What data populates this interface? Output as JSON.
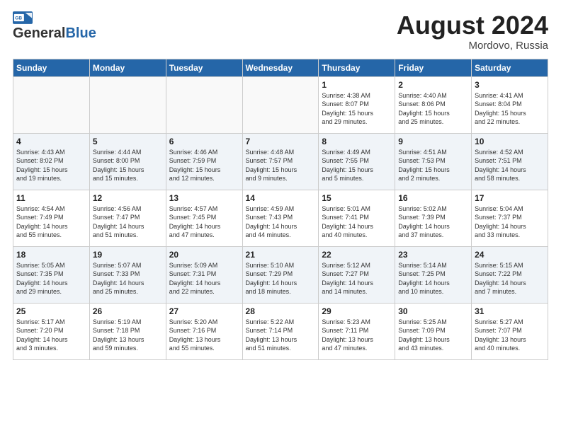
{
  "header": {
    "logo_general": "General",
    "logo_blue": "Blue",
    "month_title": "August 2024",
    "location": "Mordovo, Russia"
  },
  "days_of_week": [
    "Sunday",
    "Monday",
    "Tuesday",
    "Wednesday",
    "Thursday",
    "Friday",
    "Saturday"
  ],
  "weeks": [
    [
      {
        "num": "",
        "info": ""
      },
      {
        "num": "",
        "info": ""
      },
      {
        "num": "",
        "info": ""
      },
      {
        "num": "",
        "info": ""
      },
      {
        "num": "1",
        "info": "Sunrise: 4:38 AM\nSunset: 8:07 PM\nDaylight: 15 hours\nand 29 minutes."
      },
      {
        "num": "2",
        "info": "Sunrise: 4:40 AM\nSunset: 8:06 PM\nDaylight: 15 hours\nand 25 minutes."
      },
      {
        "num": "3",
        "info": "Sunrise: 4:41 AM\nSunset: 8:04 PM\nDaylight: 15 hours\nand 22 minutes."
      }
    ],
    [
      {
        "num": "4",
        "info": "Sunrise: 4:43 AM\nSunset: 8:02 PM\nDaylight: 15 hours\nand 19 minutes."
      },
      {
        "num": "5",
        "info": "Sunrise: 4:44 AM\nSunset: 8:00 PM\nDaylight: 15 hours\nand 15 minutes."
      },
      {
        "num": "6",
        "info": "Sunrise: 4:46 AM\nSunset: 7:59 PM\nDaylight: 15 hours\nand 12 minutes."
      },
      {
        "num": "7",
        "info": "Sunrise: 4:48 AM\nSunset: 7:57 PM\nDaylight: 15 hours\nand 9 minutes."
      },
      {
        "num": "8",
        "info": "Sunrise: 4:49 AM\nSunset: 7:55 PM\nDaylight: 15 hours\nand 5 minutes."
      },
      {
        "num": "9",
        "info": "Sunrise: 4:51 AM\nSunset: 7:53 PM\nDaylight: 15 hours\nand 2 minutes."
      },
      {
        "num": "10",
        "info": "Sunrise: 4:52 AM\nSunset: 7:51 PM\nDaylight: 14 hours\nand 58 minutes."
      }
    ],
    [
      {
        "num": "11",
        "info": "Sunrise: 4:54 AM\nSunset: 7:49 PM\nDaylight: 14 hours\nand 55 minutes."
      },
      {
        "num": "12",
        "info": "Sunrise: 4:56 AM\nSunset: 7:47 PM\nDaylight: 14 hours\nand 51 minutes."
      },
      {
        "num": "13",
        "info": "Sunrise: 4:57 AM\nSunset: 7:45 PM\nDaylight: 14 hours\nand 47 minutes."
      },
      {
        "num": "14",
        "info": "Sunrise: 4:59 AM\nSunset: 7:43 PM\nDaylight: 14 hours\nand 44 minutes."
      },
      {
        "num": "15",
        "info": "Sunrise: 5:01 AM\nSunset: 7:41 PM\nDaylight: 14 hours\nand 40 minutes."
      },
      {
        "num": "16",
        "info": "Sunrise: 5:02 AM\nSunset: 7:39 PM\nDaylight: 14 hours\nand 37 minutes."
      },
      {
        "num": "17",
        "info": "Sunrise: 5:04 AM\nSunset: 7:37 PM\nDaylight: 14 hours\nand 33 minutes."
      }
    ],
    [
      {
        "num": "18",
        "info": "Sunrise: 5:05 AM\nSunset: 7:35 PM\nDaylight: 14 hours\nand 29 minutes."
      },
      {
        "num": "19",
        "info": "Sunrise: 5:07 AM\nSunset: 7:33 PM\nDaylight: 14 hours\nand 25 minutes."
      },
      {
        "num": "20",
        "info": "Sunrise: 5:09 AM\nSunset: 7:31 PM\nDaylight: 14 hours\nand 22 minutes."
      },
      {
        "num": "21",
        "info": "Sunrise: 5:10 AM\nSunset: 7:29 PM\nDaylight: 14 hours\nand 18 minutes."
      },
      {
        "num": "22",
        "info": "Sunrise: 5:12 AM\nSunset: 7:27 PM\nDaylight: 14 hours\nand 14 minutes."
      },
      {
        "num": "23",
        "info": "Sunrise: 5:14 AM\nSunset: 7:25 PM\nDaylight: 14 hours\nand 10 minutes."
      },
      {
        "num": "24",
        "info": "Sunrise: 5:15 AM\nSunset: 7:22 PM\nDaylight: 14 hours\nand 7 minutes."
      }
    ],
    [
      {
        "num": "25",
        "info": "Sunrise: 5:17 AM\nSunset: 7:20 PM\nDaylight: 14 hours\nand 3 minutes."
      },
      {
        "num": "26",
        "info": "Sunrise: 5:19 AM\nSunset: 7:18 PM\nDaylight: 13 hours\nand 59 minutes."
      },
      {
        "num": "27",
        "info": "Sunrise: 5:20 AM\nSunset: 7:16 PM\nDaylight: 13 hours\nand 55 minutes."
      },
      {
        "num": "28",
        "info": "Sunrise: 5:22 AM\nSunset: 7:14 PM\nDaylight: 13 hours\nand 51 minutes."
      },
      {
        "num": "29",
        "info": "Sunrise: 5:23 AM\nSunset: 7:11 PM\nDaylight: 13 hours\nand 47 minutes."
      },
      {
        "num": "30",
        "info": "Sunrise: 5:25 AM\nSunset: 7:09 PM\nDaylight: 13 hours\nand 43 minutes."
      },
      {
        "num": "31",
        "info": "Sunrise: 5:27 AM\nSunset: 7:07 PM\nDaylight: 13 hours\nand 40 minutes."
      }
    ]
  ]
}
